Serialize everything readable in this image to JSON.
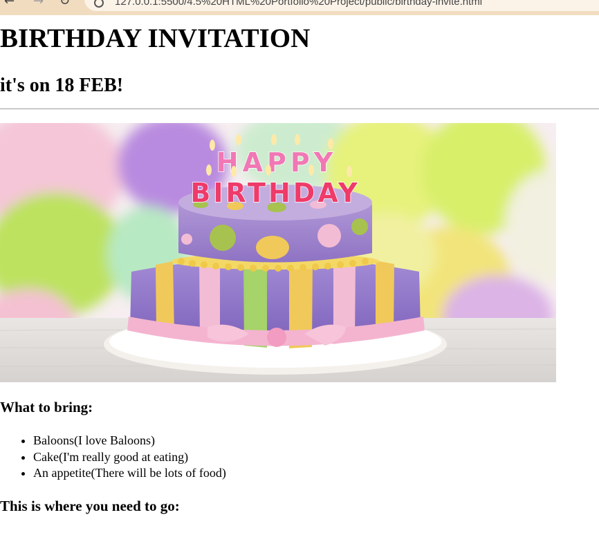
{
  "browser": {
    "address_text": "127.0.0.1:5500/4.5%20HTML%20Portfolio%20Project/public/birthday-invite.html",
    "back_glyph": "←",
    "forward_glyph": "→",
    "reload_glyph": "↻"
  },
  "page": {
    "title": "BIRTHDAY INVITATION",
    "subtitle": "it's on 18 FEB!",
    "image_icon": "birthday-cake-image",
    "image_cake_text_top": "HAPPY",
    "image_cake_text_bottom": "BIRTHDAY",
    "bring_heading": "What to bring:",
    "bring_items": [
      "Baloons(I love Baloons)",
      "Cake(I'm really good at eating)",
      "An appetite(There will be lots of food)"
    ],
    "directions_heading": "This is where you need to go:"
  },
  "colors": {
    "browser_bar": "#f1dcc0",
    "divider": "#9a9a9a"
  }
}
